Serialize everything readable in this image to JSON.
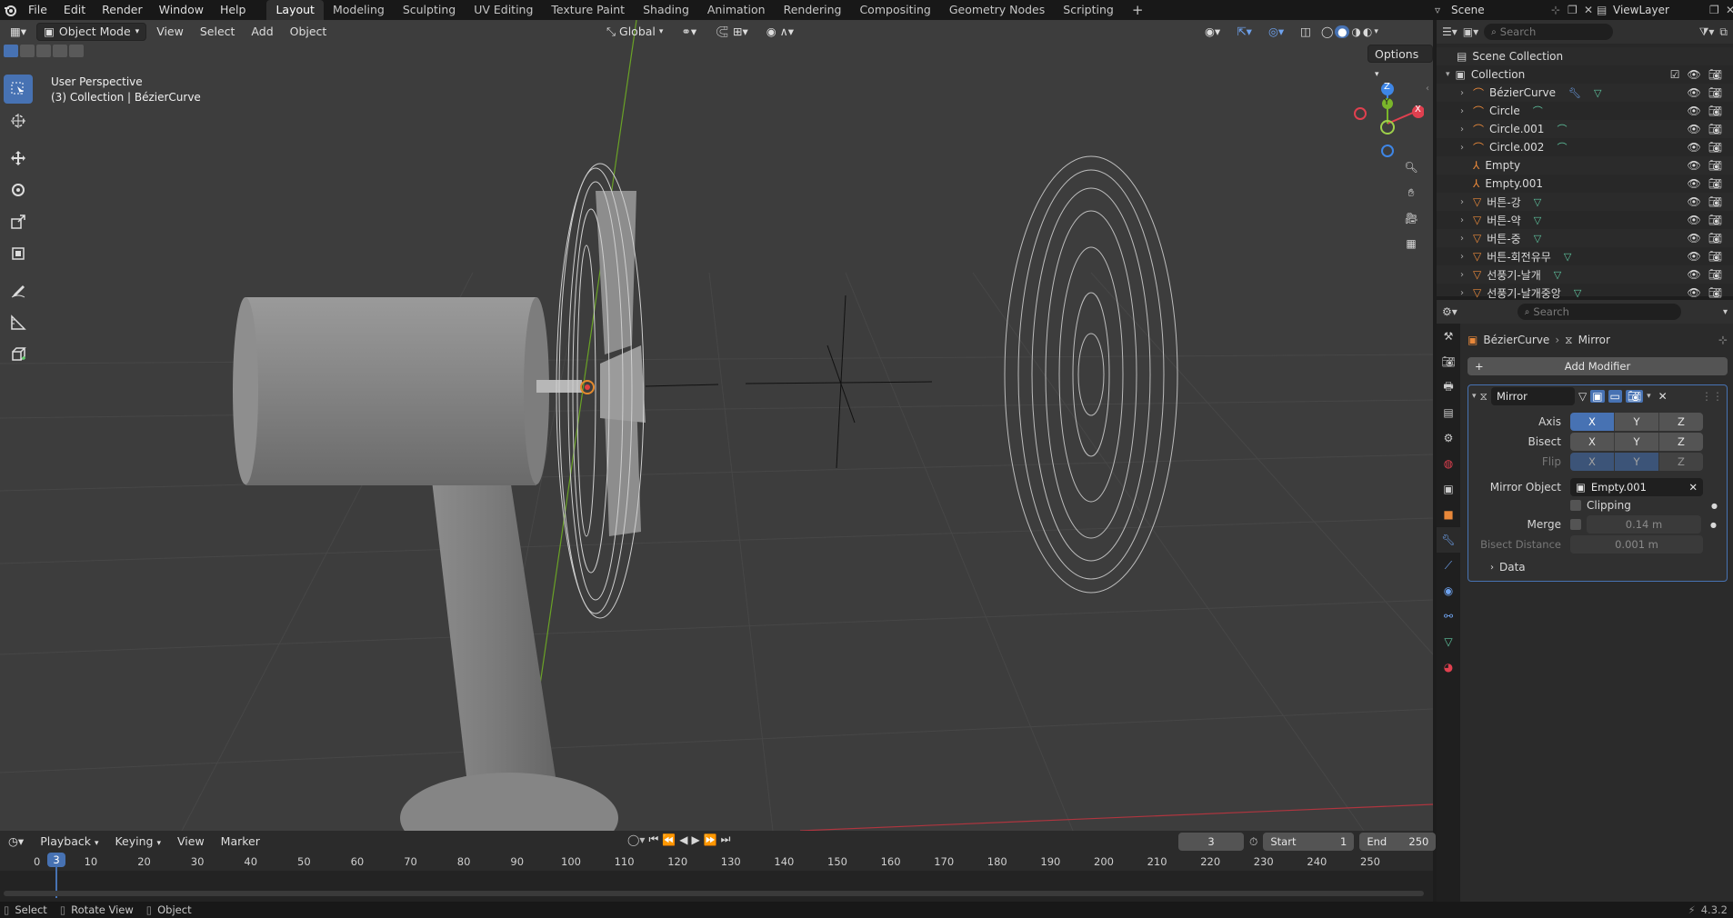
{
  "topbar": {
    "menus": [
      "File",
      "Edit",
      "Render",
      "Window",
      "Help"
    ],
    "workspaces": [
      "Layout",
      "Modeling",
      "Sculpting",
      "UV Editing",
      "Texture Paint",
      "Shading",
      "Animation",
      "Rendering",
      "Compositing",
      "Geometry Nodes",
      "Scripting"
    ],
    "active_workspace": "Layout",
    "add_tab": "+",
    "scene": "Scene",
    "view_layer": "ViewLayer"
  },
  "viewport": {
    "mode": "Object Mode",
    "menus": [
      "View",
      "Select",
      "Add",
      "Object"
    ],
    "transform_orientation": "Global",
    "options_label": "Options",
    "overlay_title": "User Perspective",
    "overlay_subtitle": "(3) Collection | BézierCurve",
    "gizmo": {
      "x": "X",
      "y": "Y",
      "z": "Z"
    }
  },
  "outliner": {
    "search_placeholder": "Search",
    "scene_collection": "Scene Collection",
    "collection": "Collection",
    "items": [
      {
        "name": "BézierCurve",
        "icon": "curve-icon",
        "badges": [
          "wrench-icon",
          "mesh-data-icon"
        ],
        "expand": true
      },
      {
        "name": "Circle",
        "icon": "curve-icon",
        "badges": [
          "curve-data-icon"
        ],
        "expand": true
      },
      {
        "name": "Circle.001",
        "icon": "curve-icon",
        "badges": [
          "curve-data-icon"
        ],
        "expand": true
      },
      {
        "name": "Circle.002",
        "icon": "curve-icon",
        "badges": [
          "curve-data-icon"
        ],
        "expand": true
      },
      {
        "name": "Empty",
        "icon": "empty-icon",
        "badges": [],
        "expand": false
      },
      {
        "name": "Empty.001",
        "icon": "empty-icon",
        "badges": [],
        "expand": false
      },
      {
        "name": "버튼-강",
        "icon": "mesh-icon",
        "badges": [
          "mesh-data-icon"
        ],
        "expand": true
      },
      {
        "name": "버튼-약",
        "icon": "mesh-icon",
        "badges": [
          "mesh-data-icon"
        ],
        "expand": true
      },
      {
        "name": "버튼-중",
        "icon": "mesh-icon",
        "badges": [
          "mesh-data-icon"
        ],
        "expand": true
      },
      {
        "name": "버튼-회전유무",
        "icon": "mesh-icon",
        "badges": [
          "mesh-data-icon"
        ],
        "expand": true
      },
      {
        "name": "선풍기-날개",
        "icon": "mesh-icon",
        "badges": [
          "mesh-data-icon"
        ],
        "expand": true
      },
      {
        "name": "선풍기-날개중앙",
        "icon": "mesh-icon",
        "badges": [
          "mesh-data-icon"
        ],
        "expand": true
      }
    ]
  },
  "properties": {
    "search_placeholder": "Search",
    "breadcrumb_object": "BézierCurve",
    "breadcrumb_modifier": "Mirror",
    "add_modifier": "Add Modifier",
    "modifier": {
      "name": "Mirror",
      "axis_label": "Axis",
      "bisect_label": "Bisect",
      "flip_label": "Flip",
      "axes": [
        "X",
        "Y",
        "Z"
      ],
      "axis_on": [
        true,
        false,
        false
      ],
      "bisect_on": [
        false,
        false,
        false
      ],
      "flip_on": [
        true,
        true,
        false
      ],
      "mirror_object_label": "Mirror Object",
      "mirror_object": "Empty.001",
      "clipping_label": "Clipping",
      "merge_label": "Merge",
      "merge_value": "0.14 m",
      "bisect_distance_label": "Bisect Distance",
      "bisect_distance_value": "0.001 m",
      "data_label": "Data"
    }
  },
  "timeline": {
    "menus": [
      "Playback",
      "Keying",
      "View",
      "Marker"
    ],
    "current_frame": "3",
    "start_label": "Start",
    "start": "1",
    "end_label": "End",
    "end": "250",
    "ruler": [
      "0",
      "10",
      "20",
      "30",
      "40",
      "50",
      "60",
      "70",
      "80",
      "90",
      "100",
      "110",
      "120",
      "130",
      "140",
      "150",
      "160",
      "170",
      "180",
      "190",
      "200",
      "210",
      "220",
      "230",
      "240",
      "250"
    ]
  },
  "statusbar": {
    "select": "Select",
    "rotate": "Rotate View",
    "object": "Object",
    "version": "4.3.2"
  },
  "colors": {
    "accent": "#4772b3",
    "x_axis": "#e0404f",
    "y_axis": "#7ab62a",
    "z_axis": "#3e86e6",
    "object_orange": "#e8883a",
    "data_green": "#5fc6a0"
  }
}
